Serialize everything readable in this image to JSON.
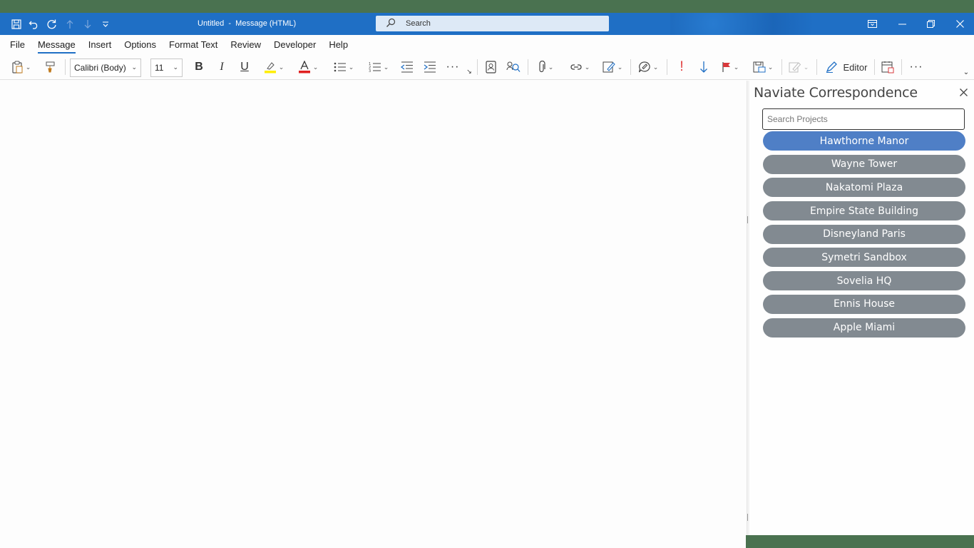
{
  "window": {
    "title": "Untitled  -  Message (HTML)",
    "search_placeholder": "Search"
  },
  "menu": {
    "tabs": [
      "File",
      "Message",
      "Insert",
      "Options",
      "Format Text",
      "Review",
      "Developer",
      "Help"
    ],
    "active": "Message"
  },
  "ribbon": {
    "font_name": "Calibri (Body)",
    "font_size": "11",
    "editor_label": "Editor",
    "accent_red": "#e03a3a",
    "accent_blue": "#1f6fc5"
  },
  "pane": {
    "title": "Naviate Correspondence",
    "search_placeholder": "Search Projects",
    "projects": [
      "Hawthorne Manor",
      "Wayne Tower",
      "Nakatomi Plaza",
      "Empire State Building",
      "Disneyland Paris",
      "Symetri Sandbox",
      "Sovelia HQ",
      "Ennis House",
      "Apple Miami"
    ],
    "selected_index": 0
  },
  "icons": {
    "save": "save-icon",
    "undo": "undo-icon",
    "redo": "redo-icon",
    "up": "arrow-up-icon",
    "down": "arrow-down-icon",
    "customize": "customize-qat-icon",
    "search": "search-icon",
    "close": "close-icon"
  }
}
